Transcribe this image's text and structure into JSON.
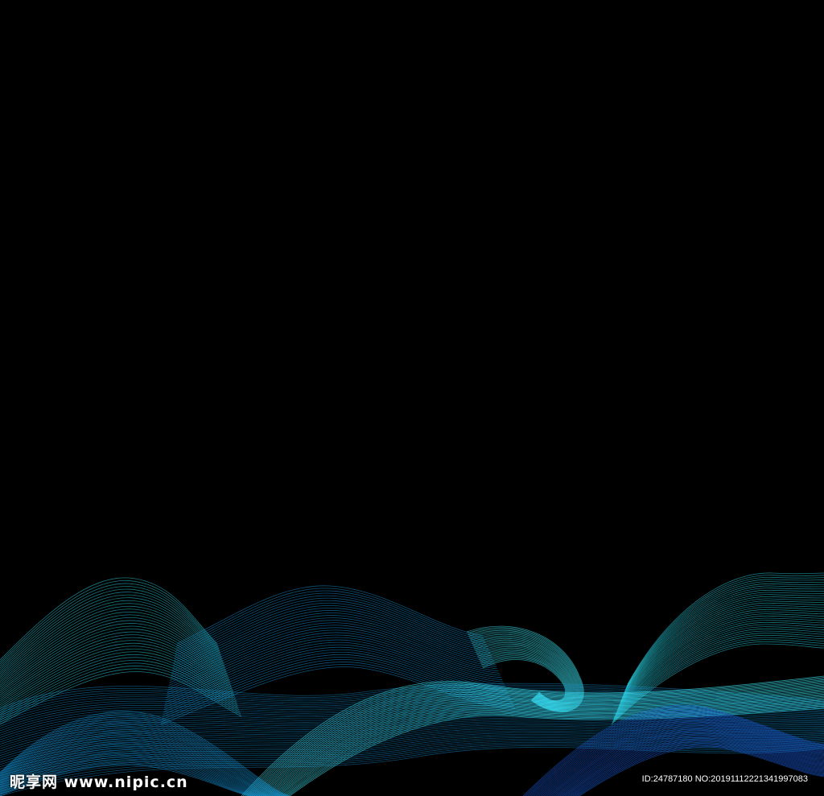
{
  "background_color": "#000000",
  "wave_colors": [
    "#2ad6e6",
    "#1aa6f0",
    "#1e62e8",
    "#3ff0ff"
  ],
  "watermark": {
    "logo_text": "昵享网 www.nipic.cn",
    "id_text": "ID:24787180 NO:20191112221341997083"
  }
}
